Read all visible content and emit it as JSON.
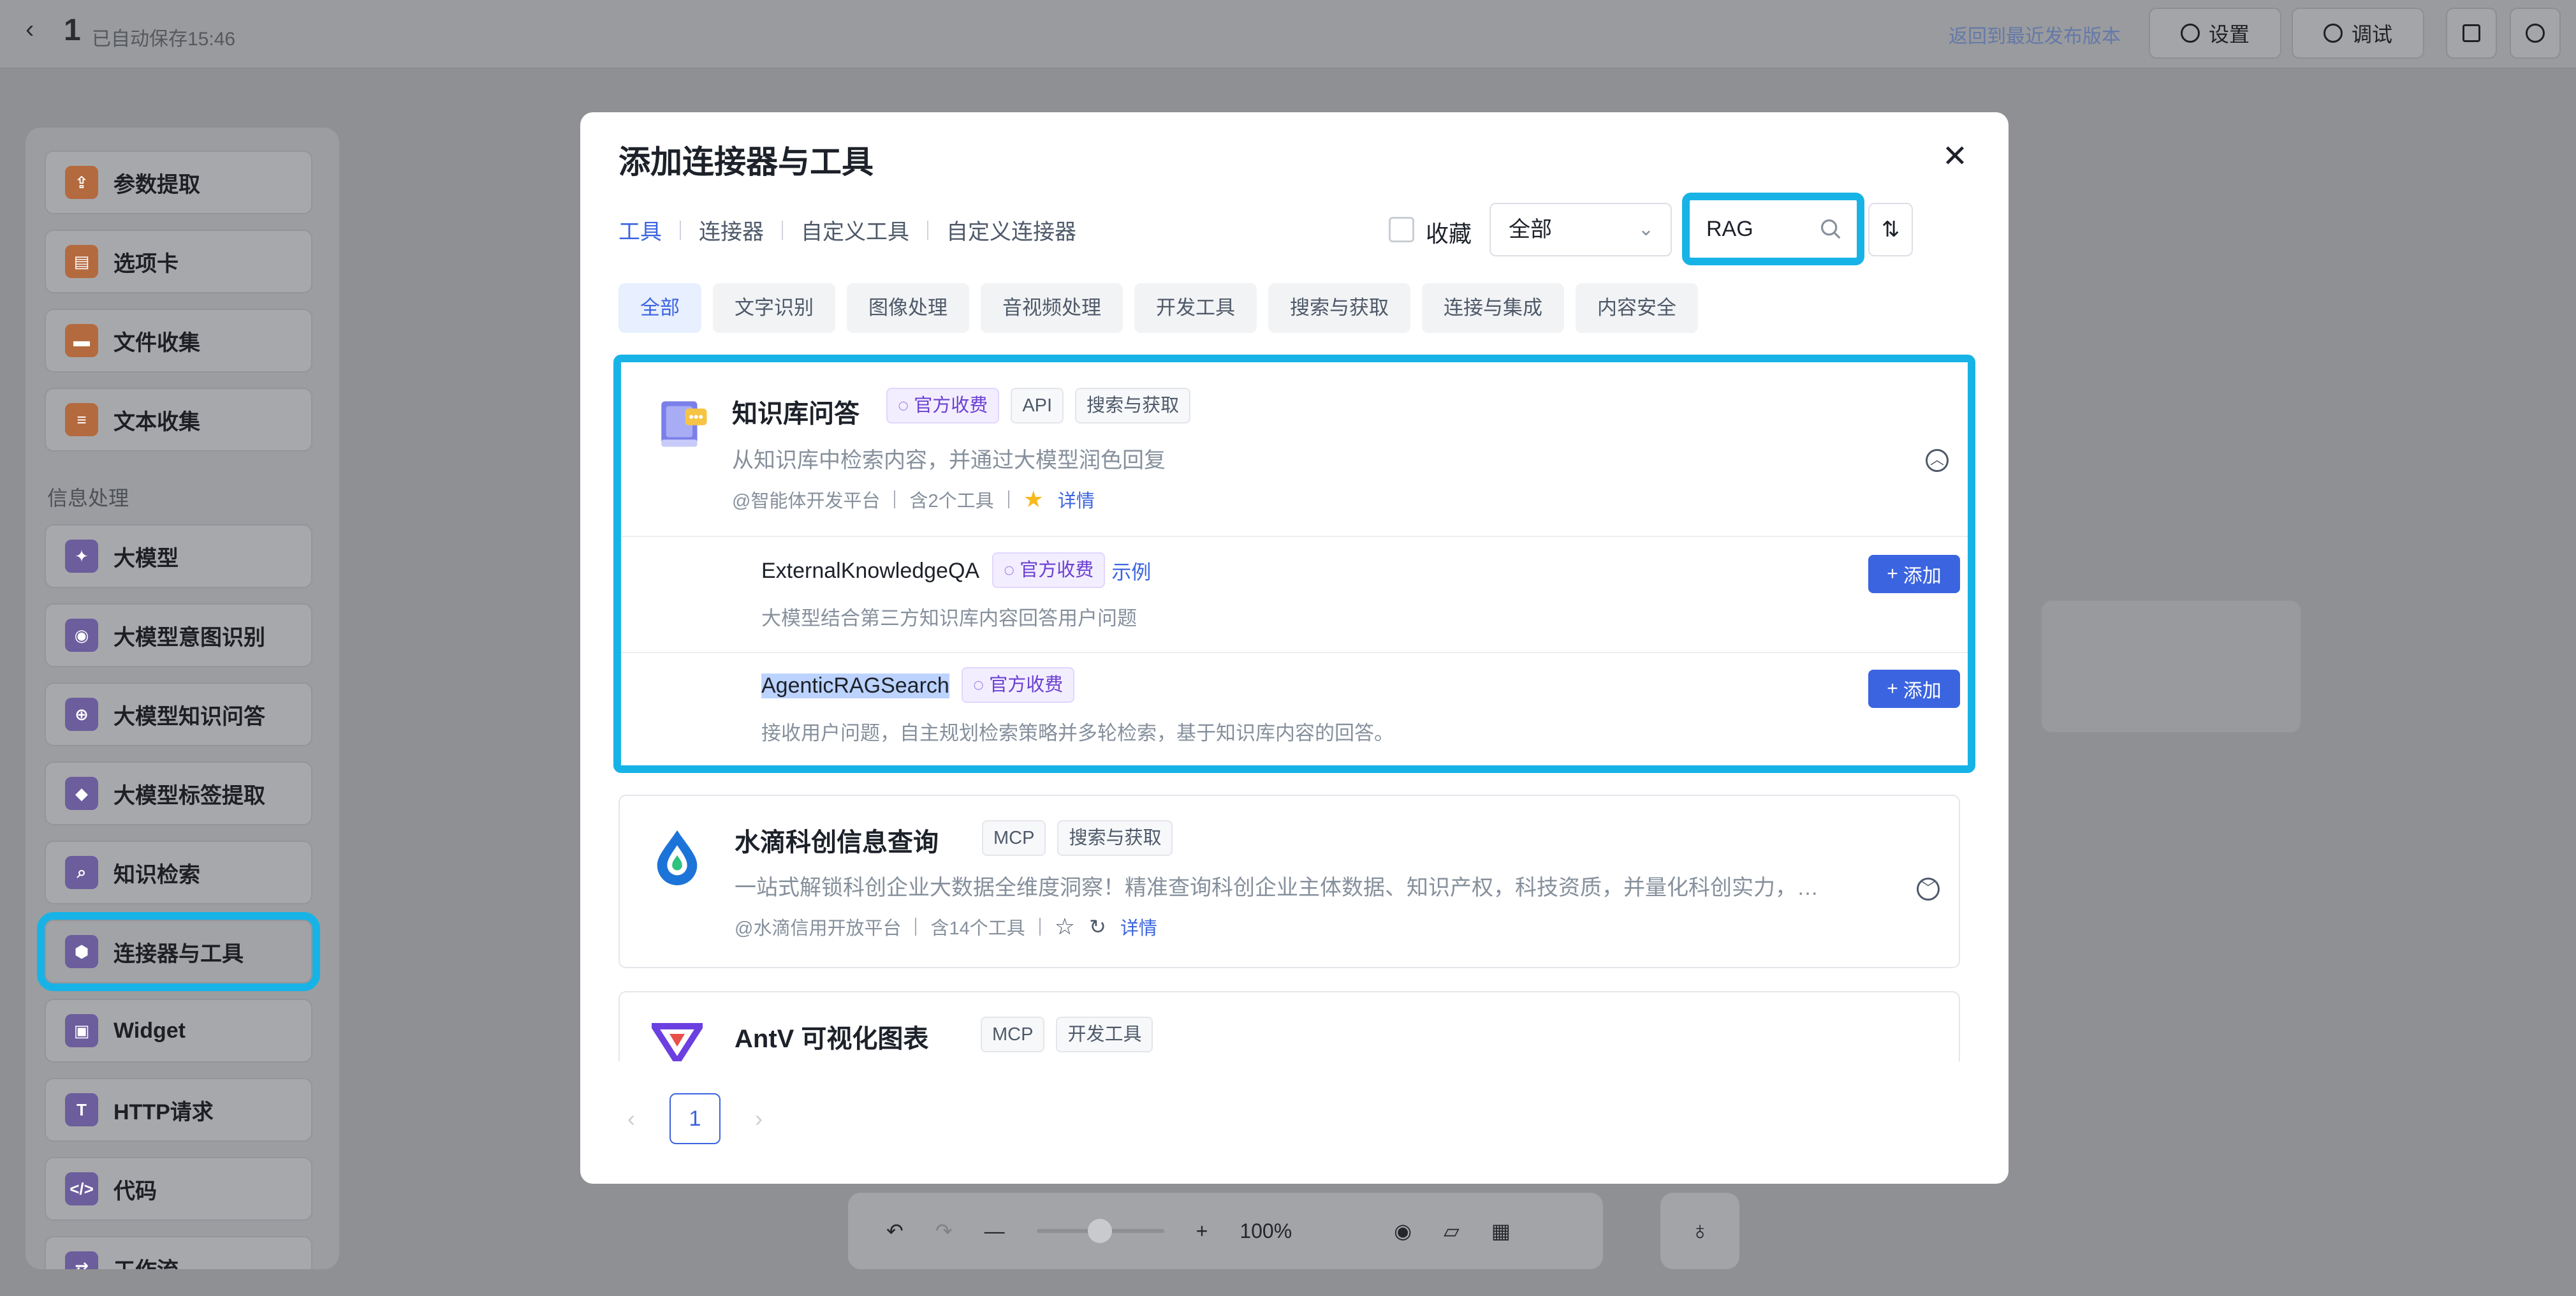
{
  "topbar": {
    "title": "1",
    "autosave": "已自动保存15:46",
    "revert_link": "返回到最近发布版本",
    "settings": "设置",
    "debug": "调试"
  },
  "sidebar": {
    "items_top": [
      "参数提取",
      "选项卡",
      "文件收集",
      "文本收集"
    ],
    "section": "信息处理",
    "items": [
      "大模型",
      "大模型意图识别",
      "大模型知识问答",
      "大模型标签提取",
      "知识检索",
      "连接器与工具",
      "Widget",
      "HTTP请求",
      "代码",
      "工作流"
    ]
  },
  "bottom_toolbar": {
    "zoom": "100%"
  },
  "modal": {
    "title": "添加连接器与工具",
    "tabs": [
      "工具",
      "连接器",
      "自定义工具",
      "自定义连接器"
    ],
    "favorites_label": "收藏",
    "filter_value": "全部",
    "search_value": "RAG",
    "categories": [
      "全部",
      "文字识别",
      "图像处理",
      "音视频处理",
      "开发工具",
      "搜索与获取",
      "连接与集成",
      "内容安全"
    ],
    "card1": {
      "name": "知识库问答",
      "tags": [
        "官方收费",
        "API",
        "搜索与获取"
      ],
      "desc": "从知识库中检索内容，并通过大模型润色回复",
      "publisher": "@智能体开发平台",
      "tool_count": "含2个工具",
      "detail": "详情",
      "tools": [
        {
          "name": "ExternalKnowledgeQA",
          "tag": "官方收费",
          "example": "示例",
          "desc": "大模型结合第三方知识库内容回答用户问题",
          "add": "添加"
        },
        {
          "name": "AgenticRAGSearch",
          "tag": "官方收费",
          "desc": "接收用户问题，自主规划检索策略并多轮检索，基于知识库内容的回答。",
          "add": "添加"
        }
      ]
    },
    "card2": {
      "name": "水滴科创信息查询",
      "tags": [
        "MCP",
        "搜索与获取"
      ],
      "desc": "一站式解锁科创企业大数据全维度洞察！精准查询科创企业主体数据、知识产权，科技资质，并量化科创实力，…",
      "publisher": "@水滴信用开放平台",
      "tool_count": "含14个工具",
      "detail": "详情"
    },
    "card3": {
      "name": "AntV 可视化图表",
      "tags": [
        "MCP",
        "开发工具"
      ]
    },
    "pager": {
      "current": "1"
    }
  },
  "colors": {
    "accent": "#3b64e0",
    "highlight": "#18b3e6",
    "paid_tag": "#6a3fd1",
    "star": "#f7ba1e"
  }
}
